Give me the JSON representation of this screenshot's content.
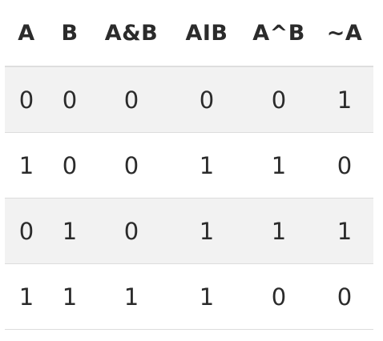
{
  "table": {
    "headers": [
      "A",
      "B",
      "A&B",
      "AIB",
      "A^B",
      "~A"
    ],
    "rows": [
      [
        "0",
        "0",
        "0",
        "0",
        "0",
        "1"
      ],
      [
        "1",
        "0",
        "0",
        "1",
        "1",
        "0"
      ],
      [
        "0",
        "1",
        "0",
        "1",
        "1",
        "1"
      ],
      [
        "1",
        "1",
        "1",
        "1",
        "0",
        "0"
      ]
    ],
    "row_shading": "alternate",
    "shade_color": "#f2f2f2",
    "divider_color": "#dcdcdc"
  }
}
